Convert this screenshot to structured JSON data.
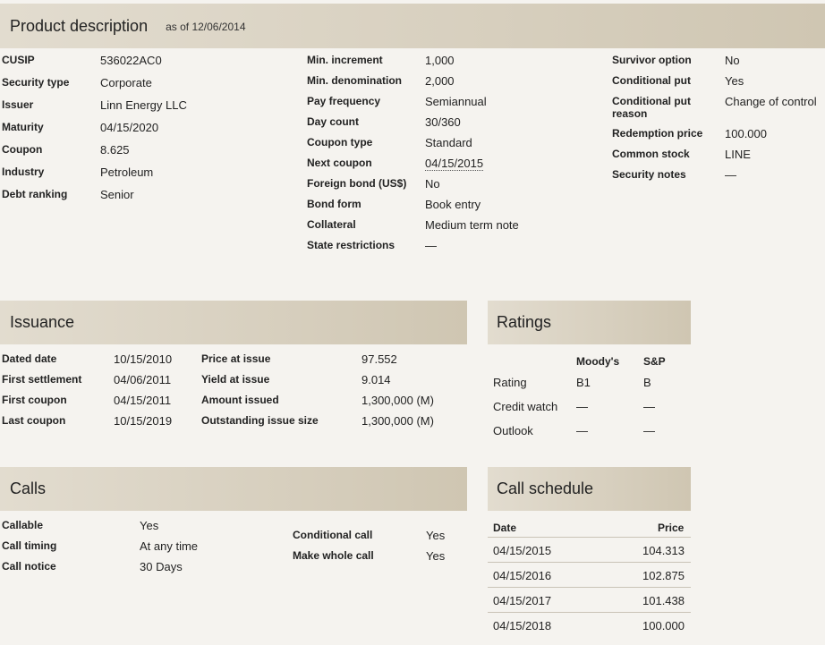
{
  "product": {
    "title": "Product description",
    "as_of": "as of 12/06/2014",
    "col1": [
      {
        "label": "CUSIP",
        "value": "536022AC0"
      },
      {
        "label": "Security type",
        "value": "Corporate"
      },
      {
        "label": "Issuer",
        "value": "Linn Energy LLC"
      },
      {
        "label": "Maturity",
        "value": "04/15/2020"
      },
      {
        "label": "Coupon",
        "value": "8.625"
      },
      {
        "label": "Industry",
        "value": "Petroleum"
      },
      {
        "label": "Debt ranking",
        "value": "Senior"
      }
    ],
    "col2": [
      {
        "label": "Min. increment",
        "value": "1,000"
      },
      {
        "label": "Min. denomination",
        "value": "2,000"
      },
      {
        "label": "Pay frequency",
        "value": "Semiannual"
      },
      {
        "label": "Day count",
        "value": "30/360"
      },
      {
        "label": "Coupon type",
        "value": "Standard"
      },
      {
        "label": "Next coupon",
        "value": "04/15/2015"
      },
      {
        "label": "Foreign bond (US$)",
        "value": "No"
      },
      {
        "label": "Bond form",
        "value": "Book entry"
      },
      {
        "label": "Collateral",
        "value": "Medium term note"
      },
      {
        "label": "State restrictions",
        "value": "—"
      }
    ],
    "col3": [
      {
        "label": "Survivor option",
        "value": "No"
      },
      {
        "label": "Conditional put",
        "value": "Yes"
      },
      {
        "label": "Conditional put reason",
        "value": "Change of control"
      },
      {
        "label": "Redemption price",
        "value": "100.000"
      },
      {
        "label": "Common stock",
        "value": "LINE"
      },
      {
        "label": "Security notes",
        "value": "—"
      }
    ]
  },
  "issuance": {
    "title": "Issuance",
    "col1": [
      {
        "label": "Dated date",
        "value": "10/15/2010"
      },
      {
        "label": "First settlement",
        "value": "04/06/2011"
      },
      {
        "label": "First coupon",
        "value": "04/15/2011"
      },
      {
        "label": "Last coupon",
        "value": "10/15/2019"
      }
    ],
    "col2": [
      {
        "label": "Price at issue",
        "value": "97.552"
      },
      {
        "label": "Yield at issue",
        "value": "9.014"
      },
      {
        "label": "Amount issued",
        "value": "1,300,000 (M)"
      },
      {
        "label": "Outstanding issue size",
        "value": "1,300,000 (M)"
      }
    ]
  },
  "ratings": {
    "title": "Ratings",
    "col_moodys": "Moody's",
    "col_sp": "S&P",
    "rows": [
      {
        "label": "Rating",
        "moodys": "B1",
        "sp": "B"
      },
      {
        "label": "Credit watch",
        "moodys": "—",
        "sp": "—"
      },
      {
        "label": "Outlook",
        "moodys": "—",
        "sp": "—"
      }
    ]
  },
  "calls": {
    "title": "Calls",
    "col1": [
      {
        "label": "Callable",
        "value": "Yes"
      },
      {
        "label": "Call timing",
        "value": "At any time"
      },
      {
        "label": "Call notice",
        "value": "30 Days"
      }
    ],
    "col2": [
      {
        "label": "Conditional call",
        "value": "Yes"
      },
      {
        "label": "Make whole call",
        "value": "Yes"
      }
    ]
  },
  "schedule": {
    "title": "Call schedule",
    "col_date": "Date",
    "col_price": "Price",
    "rows": [
      {
        "date": "04/15/2015",
        "price": "104.313"
      },
      {
        "date": "04/15/2016",
        "price": "102.875"
      },
      {
        "date": "04/15/2017",
        "price": "101.438"
      },
      {
        "date": "04/15/2018",
        "price": "100.000"
      }
    ]
  }
}
